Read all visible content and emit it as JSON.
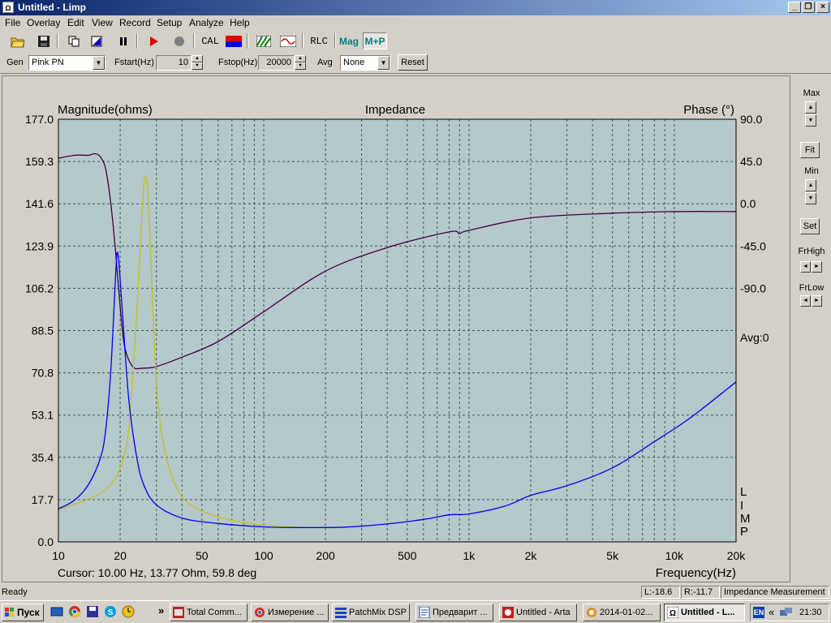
{
  "window": {
    "title": "Untitled - Limp",
    "icon_text": "Ω"
  },
  "menu": [
    "File",
    "Overlay",
    "Edit",
    "View",
    "Record",
    "Setup",
    "Analyze",
    "Help"
  ],
  "toolbar": {
    "cal_label": "CAL",
    "rlc_label": "RLC",
    "mag_label": "Mag",
    "mp_label": "M+P"
  },
  "params": {
    "gen_label": "Gen",
    "gen_value": "Pink PN",
    "fstart_label": "Fstart(Hz)",
    "fstart_value": "10",
    "fstop_label": "Fstop(Hz)",
    "fstop_value": "20000",
    "avg_label": "Avg",
    "avg_value": "None",
    "reset_label": "Reset"
  },
  "right_panel": {
    "max_label": "Max",
    "fit_label": "Fit",
    "min_label": "Min",
    "set_label": "Set",
    "frhigh_label": "FrHigh",
    "frlow_label": "FrLow"
  },
  "plot": {
    "title": "Impedance",
    "y_left_label": "Magnitude(ohms)",
    "y_right_label": "Phase (°)",
    "x_label": "Frequency(Hz)",
    "avg_text": "Avg:0",
    "watermark": [
      "L",
      "I",
      "M",
      "P"
    ],
    "cursor_text": "Cursor: 10.00 Hz, 13.77 Ohm, 59.8 deg",
    "colors": {
      "background": "#b5c8cb",
      "grid": "#375f4f",
      "magnitude": "#0000ee",
      "overlay": "#c2c21a",
      "phase": "#400040"
    }
  },
  "chart_data": {
    "type": "line",
    "title": "Impedance",
    "xlabel": "Frequency(Hz)",
    "ylabel": "Magnitude(ohms)",
    "y2label": "Phase (°)",
    "xscale": "log",
    "xlim": [
      10,
      20000
    ],
    "ylim": [
      0,
      177
    ],
    "y2lim": [
      -180,
      90
    ],
    "x_ticks": [
      "10",
      "20",
      "50",
      "100",
      "200",
      "500",
      "1k",
      "2k",
      "5k",
      "10k",
      "20k"
    ],
    "y_ticks": [
      "177.0",
      "159.3",
      "141.6",
      "123.9",
      "106.2",
      "88.5",
      "70.8",
      "53.1",
      "35.4",
      "17.7",
      "0.0"
    ],
    "y2_ticks": [
      "90.0",
      "45.0",
      "0.0",
      "-45.0",
      "-90.0"
    ],
    "grid": true,
    "series": [
      {
        "axis": "left",
        "style": "magnitude",
        "points": [
          [
            10,
            13.8
          ],
          [
            12,
            17.5
          ],
          [
            14,
            24
          ],
          [
            16,
            35
          ],
          [
            17,
            47
          ],
          [
            18,
            72
          ],
          [
            19,
            112
          ],
          [
            19.3,
            121
          ],
          [
            19.7,
            117
          ],
          [
            20.5,
            96
          ],
          [
            22,
            60
          ],
          [
            24,
            36
          ],
          [
            26,
            24
          ],
          [
            30,
            15.5
          ],
          [
            40,
            10
          ],
          [
            60,
            7.7
          ],
          [
            100,
            6.3
          ],
          [
            150,
            6
          ],
          [
            250,
            6.2
          ],
          [
            400,
            7.5
          ],
          [
            600,
            9.4
          ],
          [
            800,
            11.3
          ],
          [
            1000,
            11.7
          ],
          [
            1500,
            15
          ],
          [
            2000,
            19.5
          ],
          [
            3000,
            23.5
          ],
          [
            5000,
            31
          ],
          [
            8000,
            42
          ],
          [
            12000,
            52
          ],
          [
            20000,
            67
          ]
        ]
      },
      {
        "axis": "left",
        "style": "overlay",
        "points": [
          [
            10,
            13.5
          ],
          [
            15,
            19
          ],
          [
            18,
            24
          ],
          [
            20,
            31
          ],
          [
            22,
            47
          ],
          [
            24,
            94
          ],
          [
            25,
            122
          ],
          [
            26,
            148
          ],
          [
            26.6,
            153
          ],
          [
            27.2,
            148
          ],
          [
            28,
            125
          ],
          [
            30,
            67
          ],
          [
            33,
            38
          ],
          [
            38,
            22
          ],
          [
            45,
            15
          ],
          [
            60,
            10.5
          ],
          [
            90,
            7.5
          ],
          [
            150,
            6.1
          ],
          [
            250,
            6
          ]
        ]
      },
      {
        "axis": "right",
        "style": "phase",
        "points": [
          [
            10,
            65
          ],
          [
            12,
            67
          ],
          [
            14,
            67
          ],
          [
            15,
            68
          ],
          [
            16,
            66
          ],
          [
            17,
            58
          ],
          [
            18,
            36
          ],
          [
            19,
            5
          ],
          [
            20,
            -30
          ],
          [
            21,
            -55
          ],
          [
            23,
            -68
          ],
          [
            26,
            -69
          ],
          [
            30,
            -68
          ],
          [
            40,
            -62
          ],
          [
            60,
            -52
          ],
          [
            100,
            -33
          ],
          [
            200,
            -7
          ],
          [
            400,
            8
          ],
          [
            800,
            18
          ],
          [
            900,
            17
          ],
          [
            1000,
            19
          ],
          [
            2000,
            27
          ],
          [
            5000,
            30
          ],
          [
            10000,
            31
          ],
          [
            20000,
            31
          ]
        ]
      }
    ]
  },
  "status": {
    "ready": "Ready",
    "left_level": "L:-18.6",
    "right_level": "R:-11.7",
    "mode": "Impedance Measurement"
  },
  "taskbar": {
    "start_label": "Пуск",
    "tasks": [
      "Total Comm...",
      "Измерение ...",
      "PatchMix DSP",
      "Предварит ...",
      "Untitled - Arta",
      "2014-01-02...",
      "Untitled - L..."
    ],
    "lang": "EN",
    "clock": "21:30"
  }
}
